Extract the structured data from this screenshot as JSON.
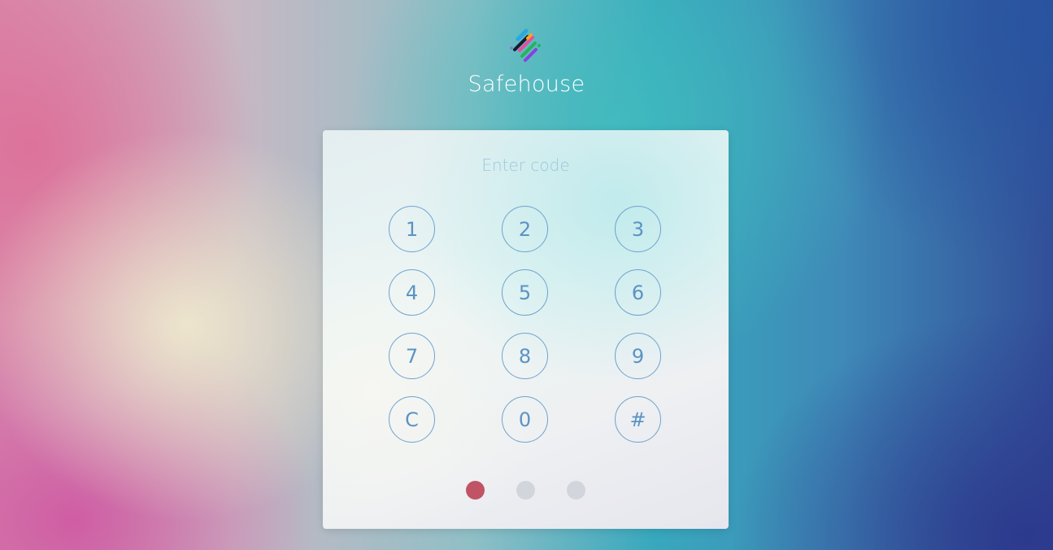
{
  "app": {
    "title": "Safehouse",
    "logo_icon": "safehouse-logo-icon"
  },
  "keypad": {
    "prompt": "Enter code",
    "keys": [
      "1",
      "2",
      "3",
      "4",
      "5",
      "6",
      "7",
      "8",
      "9",
      "C",
      "0",
      "#"
    ]
  },
  "code_progress": {
    "total_digits": 3,
    "entered_digits": 1,
    "filled_color": "#c05464",
    "empty_color": "#d3d5dd"
  },
  "colors": {
    "key_border": "#6fa3cf",
    "key_text": "#5b93c4",
    "prompt_text": "#9cc8dc"
  }
}
